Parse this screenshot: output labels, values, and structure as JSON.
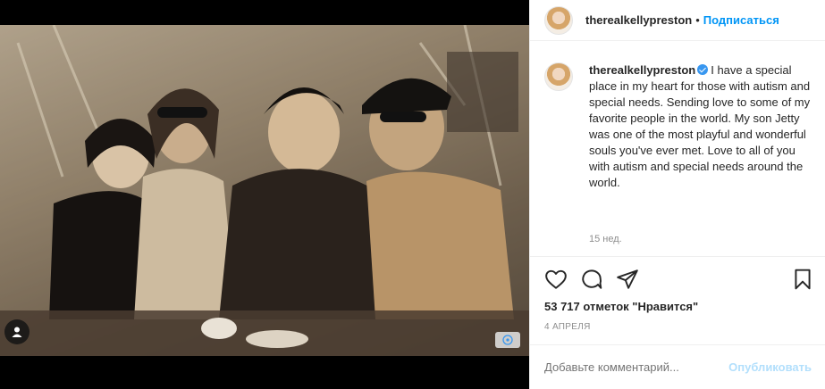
{
  "post": {
    "username": "therealkellypreston",
    "follow_label": "Подписаться",
    "separator": "•",
    "caption_username": "therealkellypreston",
    "caption_text": "I have a special place in my heart for those with autism and special needs. Sending love to some of my favorite people in the world. My son Jetty was one of the most playful and wonderful souls you've ever met. Love to all of you with autism and special needs around the world.",
    "time_ago": "15 нед.",
    "likes": "53 717 отметок \"Нравится\"",
    "date": "4 апреля",
    "comment_placeholder": "Добавьте комментарий...",
    "publish_label": "Опубликовать"
  },
  "icons": {
    "like": "heart-icon",
    "comment": "comment-icon",
    "share": "paper-plane-icon",
    "save": "bookmark-icon",
    "tag": "user-tag-icon",
    "alt": "info-icon",
    "verified": "verified-badge-icon"
  },
  "colors": {
    "link_blue": "#0095f6",
    "publish_disabled": "#b2dffc",
    "text": "#262626",
    "muted": "#8e8e8e",
    "verified": "#3897f0"
  }
}
